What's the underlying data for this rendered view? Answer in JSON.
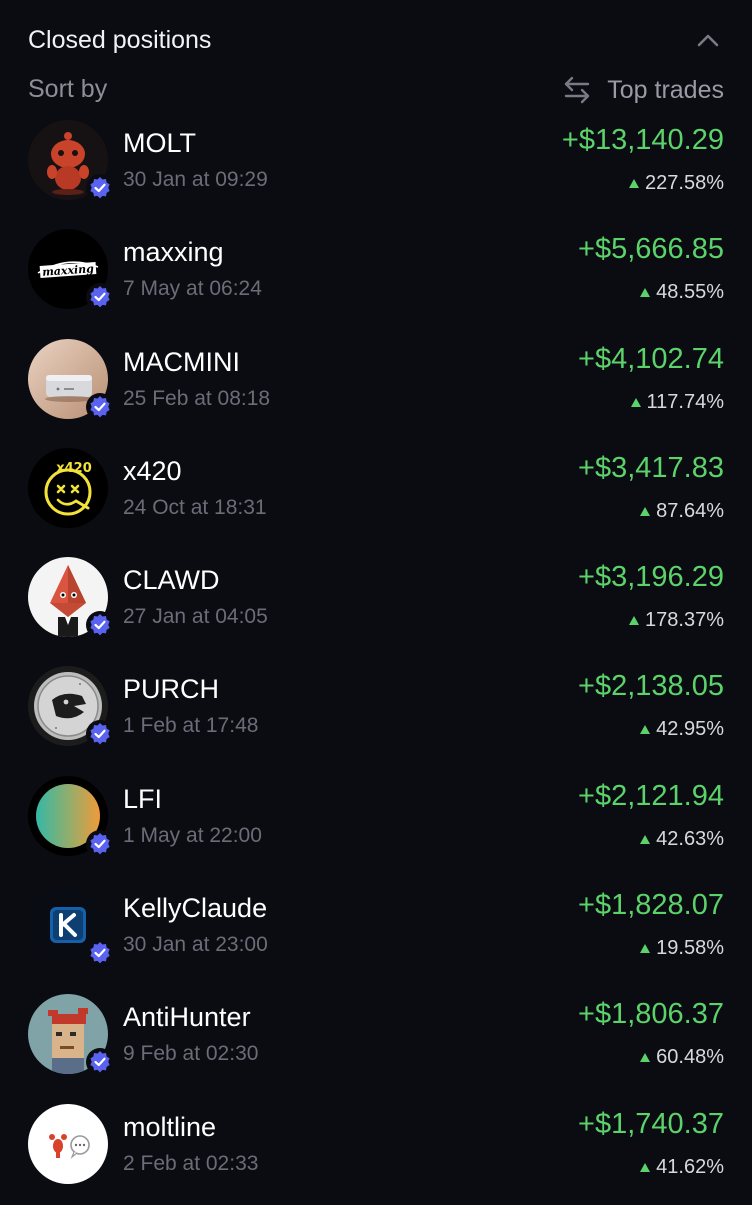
{
  "header": {
    "title": "Closed positions"
  },
  "sort": {
    "label": "Sort by",
    "value": "Top trades"
  },
  "colors": {
    "background": "#0b0b12",
    "profit_green": "#5bd36a",
    "verified_badge": "#5a63f0"
  },
  "positions": [
    {
      "name": "MOLT",
      "date": "30 Jan at 09:29",
      "pnl": "+$13,140.29",
      "pct": "227.58%",
      "avatar": "molt-avatar"
    },
    {
      "name": "maxxing",
      "date": "7 May at 06:24",
      "pnl": "+$5,666.85",
      "pct": "48.55%",
      "avatar": "maxxing-avatar"
    },
    {
      "name": "MACMINI",
      "date": "25 Feb at 08:18",
      "pnl": "+$4,102.74",
      "pct": "117.74%",
      "avatar": "macmini-avatar"
    },
    {
      "name": "x420",
      "date": "24 Oct at 18:31",
      "pnl": "+$3,417.83",
      "pct": "87.64%",
      "avatar": "x420-avatar"
    },
    {
      "name": "CLAWD",
      "date": "27 Jan at 04:05",
      "pnl": "+$3,196.29",
      "pct": "178.37%",
      "avatar": "clawd-avatar"
    },
    {
      "name": "PURCH",
      "date": "1 Feb at 17:48",
      "pnl": "+$2,138.05",
      "pct": "42.95%",
      "avatar": "purch-avatar"
    },
    {
      "name": "LFI",
      "date": "1 May at 22:00",
      "pnl": "+$2,121.94",
      "pct": "42.63%",
      "avatar": "lfi-avatar"
    },
    {
      "name": "KellyClaude",
      "date": "30 Jan at 23:00",
      "pnl": "+$1,828.07",
      "pct": "19.58%",
      "avatar": "kellyclaude-avatar"
    },
    {
      "name": "AntiHunter",
      "date": "9 Feb at 02:30",
      "pnl": "+$1,806.37",
      "pct": "60.48%",
      "avatar": "antihunter-avatar"
    },
    {
      "name": "moltline",
      "date": "2 Feb at 02:33",
      "pnl": "+$1,740.37",
      "pct": "41.62%",
      "avatar": "moltline-avatar"
    }
  ]
}
